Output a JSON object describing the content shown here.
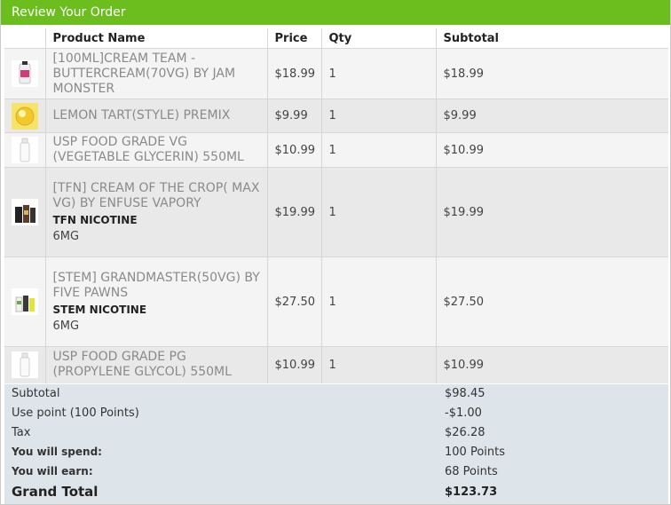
{
  "header": {
    "title": "Review Your Order"
  },
  "columns": {
    "product": "Product Name",
    "price": "Price",
    "qty": "Qty",
    "subtotal": "Subtotal"
  },
  "items": [
    {
      "name": "[100ML]CREAM TEAM - BUTTERCREAM(70VG) BY JAM MONSTER",
      "price": "$18.99",
      "qty": "1",
      "subtotal": "$18.99",
      "thumb_icon": "juice-bottle-pink-icon"
    },
    {
      "name": "LEMON TART(STYLE) PREMIX",
      "price": "$9.99",
      "qty": "1",
      "subtotal": "$9.99",
      "thumb_icon": "lemon-tart-icon"
    },
    {
      "name": "USP FOOD GRADE VG (VEGETABLE GLYCERIN) 550ML",
      "price": "$10.99",
      "qty": "1",
      "subtotal": "$10.99",
      "thumb_icon": "white-bottle-icon"
    },
    {
      "name": "[TFN] CREAM OF THE CROP( MAX VG) BY ENFUSE VAPORY",
      "option_label": "TFN NICOTINE",
      "option_value": "6MG",
      "price": "$19.99",
      "qty": "1",
      "subtotal": "$19.99",
      "thumb_icon": "dark-bottles-icon"
    },
    {
      "name": "[STEM] GRANDMASTER(50VG) BY FIVE PAWNS",
      "option_label": "STEM NICOTINE",
      "option_value": "6MG",
      "price": "$27.50",
      "qty": "1",
      "subtotal": "$27.50",
      "thumb_icon": "green-bottles-icon"
    },
    {
      "name": "USP FOOD GRADE PG (PROPYLENE GLYCOL) 550ML",
      "price": "$10.99",
      "qty": "1",
      "subtotal": "$10.99",
      "thumb_icon": "white-bottle-icon"
    }
  ],
  "totals": {
    "subtotal_label": "Subtotal",
    "subtotal_value": "$98.45",
    "points_label": "Use point (100 Points)",
    "points_value": "-$1.00",
    "tax_label": "Tax",
    "tax_value": "$26.28",
    "spend_label": "You will spend:",
    "spend_value": "100 Points",
    "earn_label": "You will earn:",
    "earn_value": "68 Points",
    "grand_label": "Grand Total",
    "grand_value": "$123.73"
  },
  "colors": {
    "header_bg": "#6cbd1e",
    "totals_bg": "#dde5ea"
  }
}
